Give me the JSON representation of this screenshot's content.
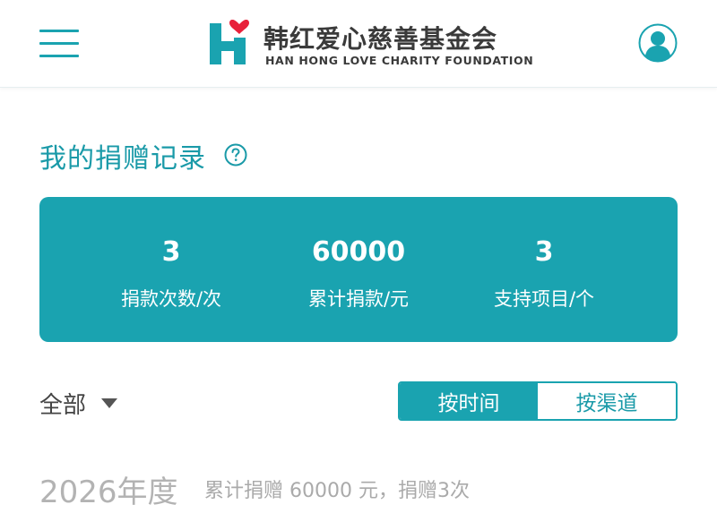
{
  "header": {
    "logo_text_cn": "韩红爱心慈善基金会",
    "logo_text_en": "HAN HONG LOVE CHARITY FOUNDATION",
    "menu_icon": "hamburger-menu-icon",
    "avatar_icon": "user-avatar-icon"
  },
  "page": {
    "title": "我的捐赠记录",
    "help_icon": "question-circle-icon"
  },
  "stats": [
    {
      "value": "3",
      "label": "捐款次数/次"
    },
    {
      "value": "60000",
      "label": "累计捐款/元"
    },
    {
      "value": "3",
      "label": "支持项目/个"
    }
  ],
  "filter": {
    "selected": "全部",
    "caret_icon": "caret-down-icon"
  },
  "sort_toggle": {
    "options": [
      "按时间",
      "按渠道"
    ],
    "active_index": 0
  },
  "year_section": {
    "title": "2026年度",
    "summary": "累计捐赠 60000 元，捐赠3次"
  },
  "colors": {
    "brand_teal": "#1aa3b0",
    "logo_red": "#e8213a",
    "muted_gray": "#b3b3b3"
  }
}
